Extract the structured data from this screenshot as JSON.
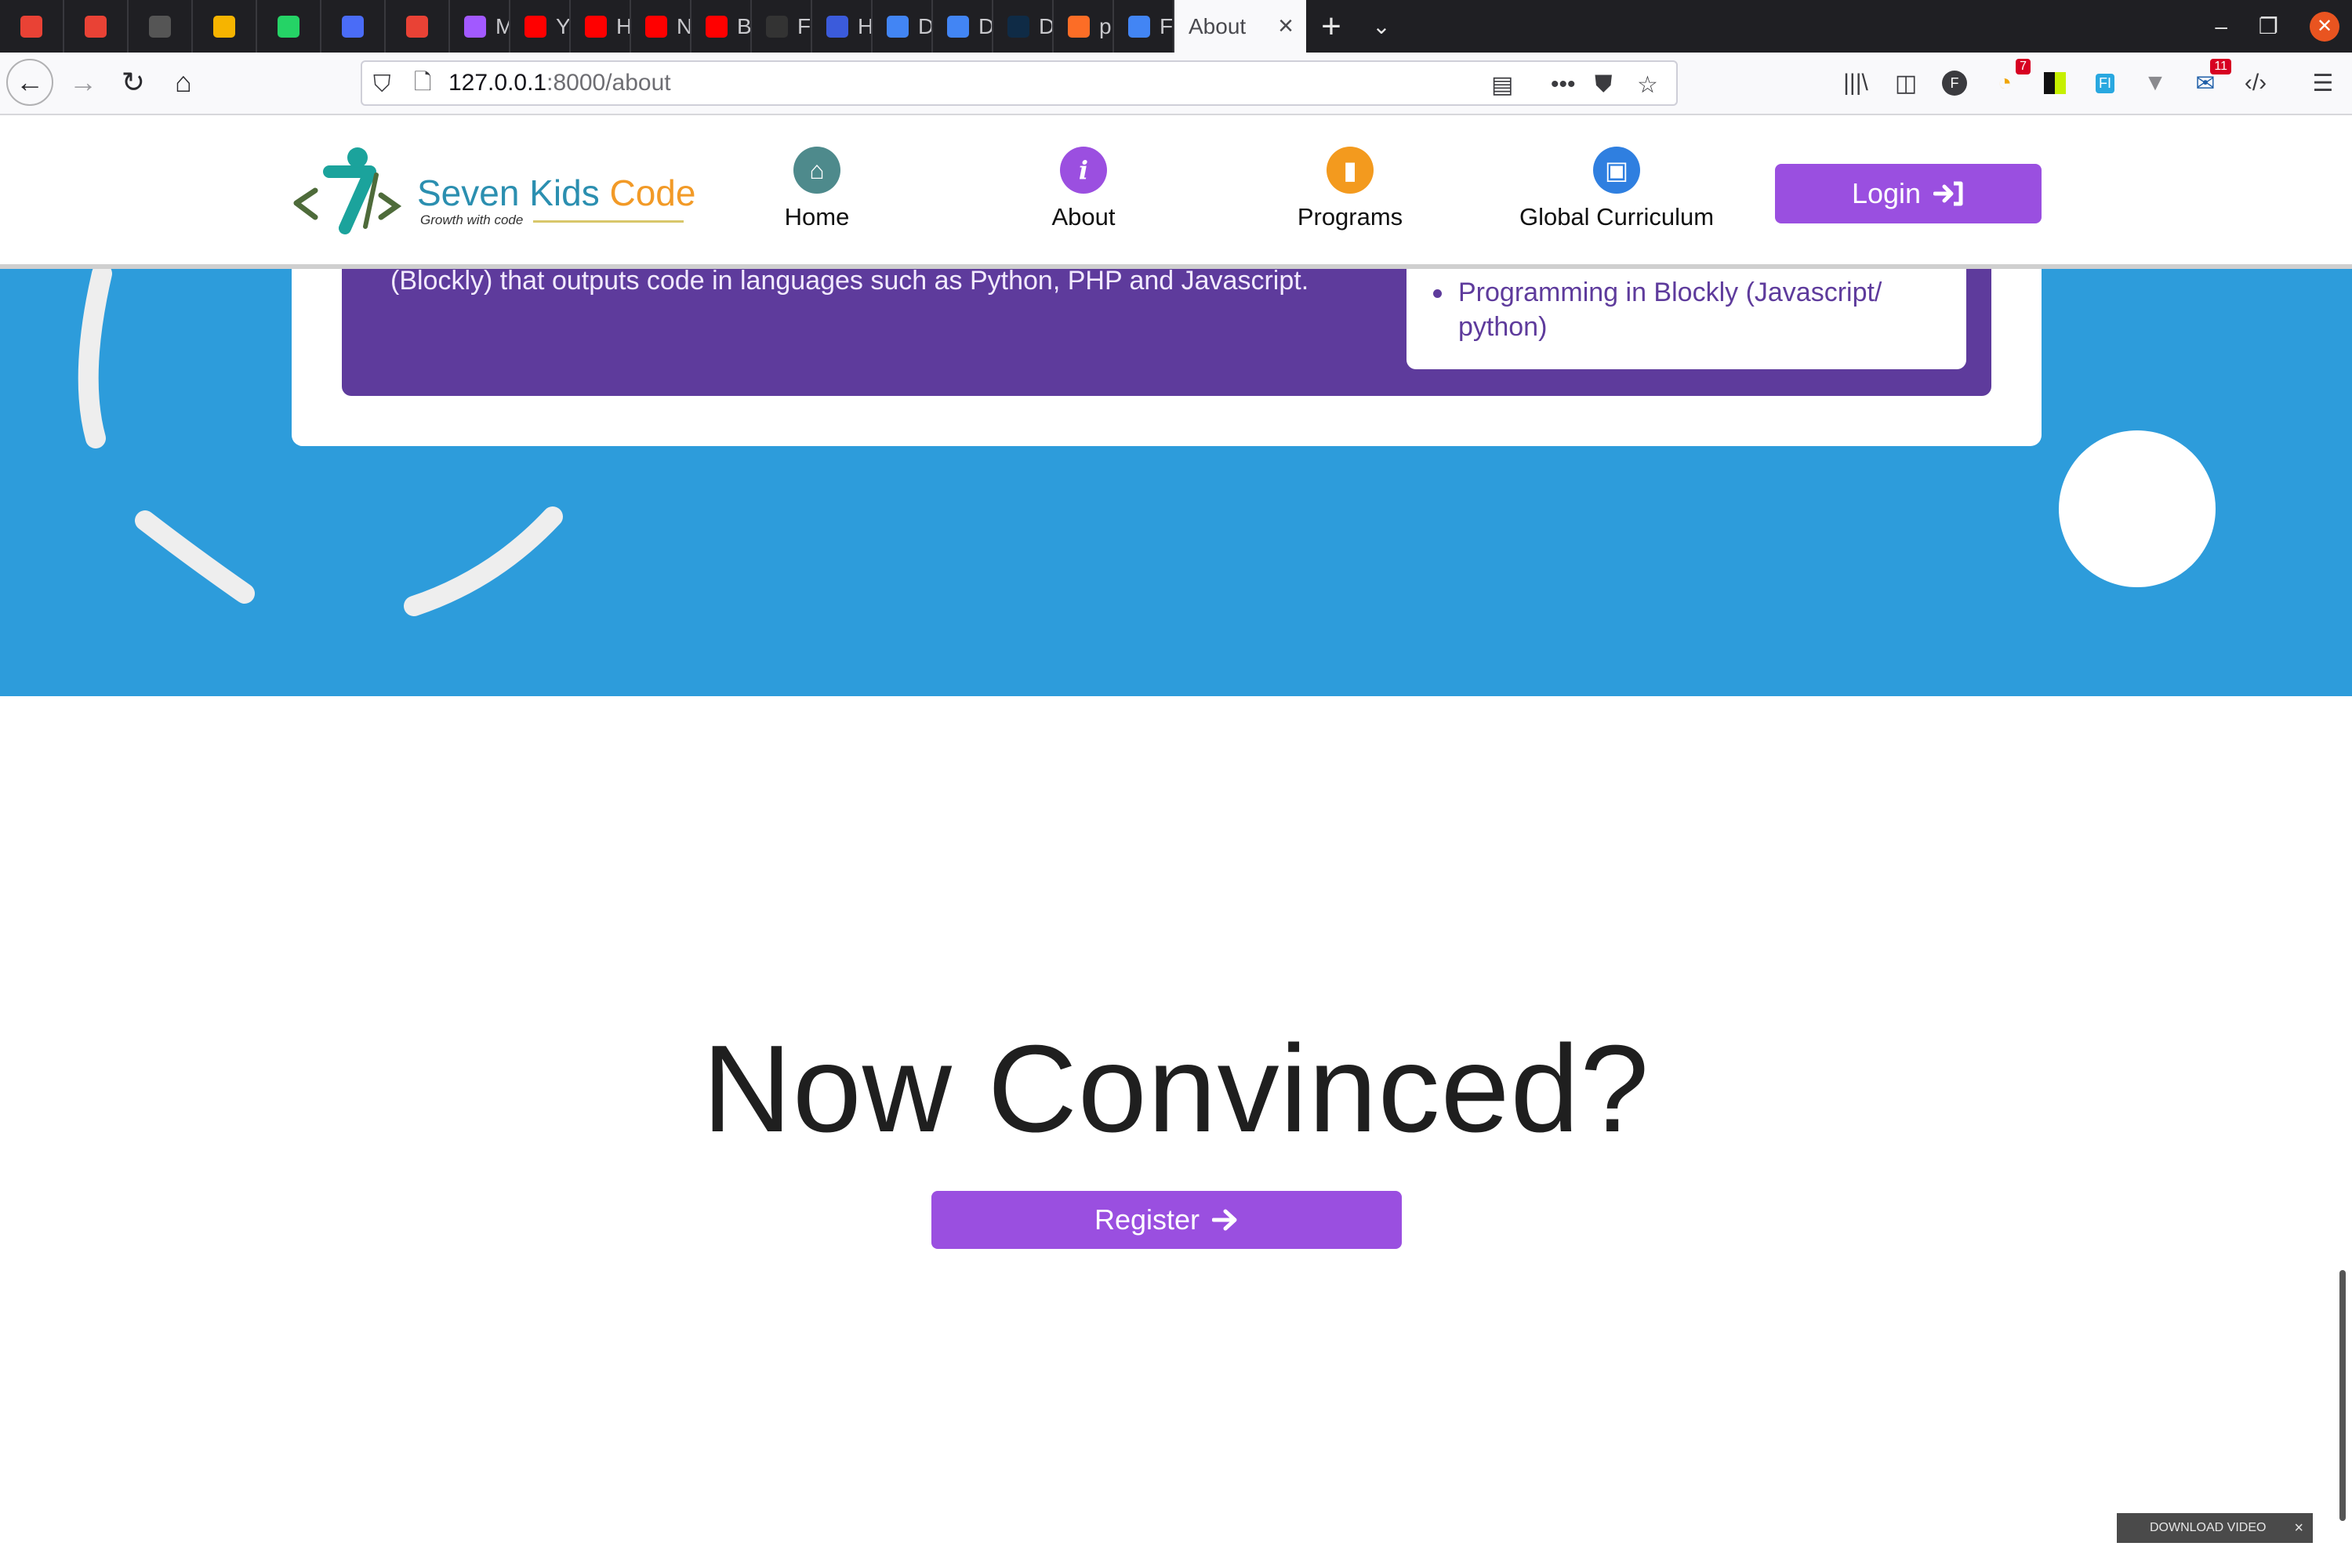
{
  "browser": {
    "tabs": [
      {
        "label": "",
        "icon": "gmail-icon",
        "color": "#e94235",
        "pinned": true
      },
      {
        "label": "",
        "icon": "gmail-icon",
        "color": "#e94235",
        "pinned": true
      },
      {
        "label": "",
        "icon": "keep-icon",
        "color": "#555555",
        "pinned": true
      },
      {
        "label": "",
        "icon": "keep-notes-icon",
        "color": "#f6b400",
        "pinned": true
      },
      {
        "label": "",
        "icon": "whatsapp-icon",
        "color": "#25d366",
        "pinned": true
      },
      {
        "label": "",
        "icon": "messenger-icon",
        "color": "#4a6cf7",
        "pinned": true
      },
      {
        "label": "",
        "icon": "gmail-icon",
        "color": "#e94235",
        "pinned": true
      },
      {
        "label": "More",
        "icon": "figma-icon",
        "color": "#a259ff"
      },
      {
        "label": "YouT",
        "icon": "youtube-icon",
        "color": "#ff0000"
      },
      {
        "label": "Hill S",
        "icon": "youtube-icon",
        "color": "#ff0000"
      },
      {
        "label": "Ni Ke",
        "icon": "youtube-icon",
        "color": "#ff0000"
      },
      {
        "label": "BAN/",
        "icon": "youtube-icon",
        "color": "#ff0000"
      },
      {
        "label": "Fenn",
        "icon": "github-icon",
        "color": "#333333"
      },
      {
        "label": "How",
        "icon": "infinity-icon",
        "color": "#3b5bdb"
      },
      {
        "label": "Digit",
        "icon": "docs-icon",
        "color": "#4285f4"
      },
      {
        "label": "Digit",
        "icon": "docs-icon",
        "color": "#4285f4"
      },
      {
        "label": "Deep",
        "icon": "deepl-icon",
        "color": "#0f2b46"
      },
      {
        "label": "progr",
        "icon": "gitlab-icon",
        "color": "#fc6d26"
      },
      {
        "label": "Food",
        "icon": "docs-icon",
        "color": "#4285f4"
      }
    ],
    "active_tab": "About",
    "url_host": "127.0.0.1",
    "url_path": ":8000/about",
    "badge_red": "7",
    "badge_mail": "11"
  },
  "site": {
    "brand_main": "Seven Kids ",
    "brand_accent": "Code",
    "tagline": "Growth with code",
    "nav": [
      {
        "label": "Home",
        "color": "#4e8a8c"
      },
      {
        "label": "About",
        "color": "#9b4fe0"
      },
      {
        "label": "Programs",
        "color": "#f39a1e"
      },
      {
        "label": "Global Curriculum",
        "color": "#2f7fe0"
      }
    ],
    "login_label": "Login",
    "accent": "#9a4fe0"
  },
  "section": {
    "description": "(Blockly) that outputs code in languages such as Python, PHP and Javascript.",
    "list_item": "Programming in Blockly (Javascript/ python)"
  },
  "cta": {
    "heading": "Now Convinced?",
    "register_label": "Register"
  },
  "overlay": {
    "download_label": "DOWNLOAD VIDEO"
  }
}
